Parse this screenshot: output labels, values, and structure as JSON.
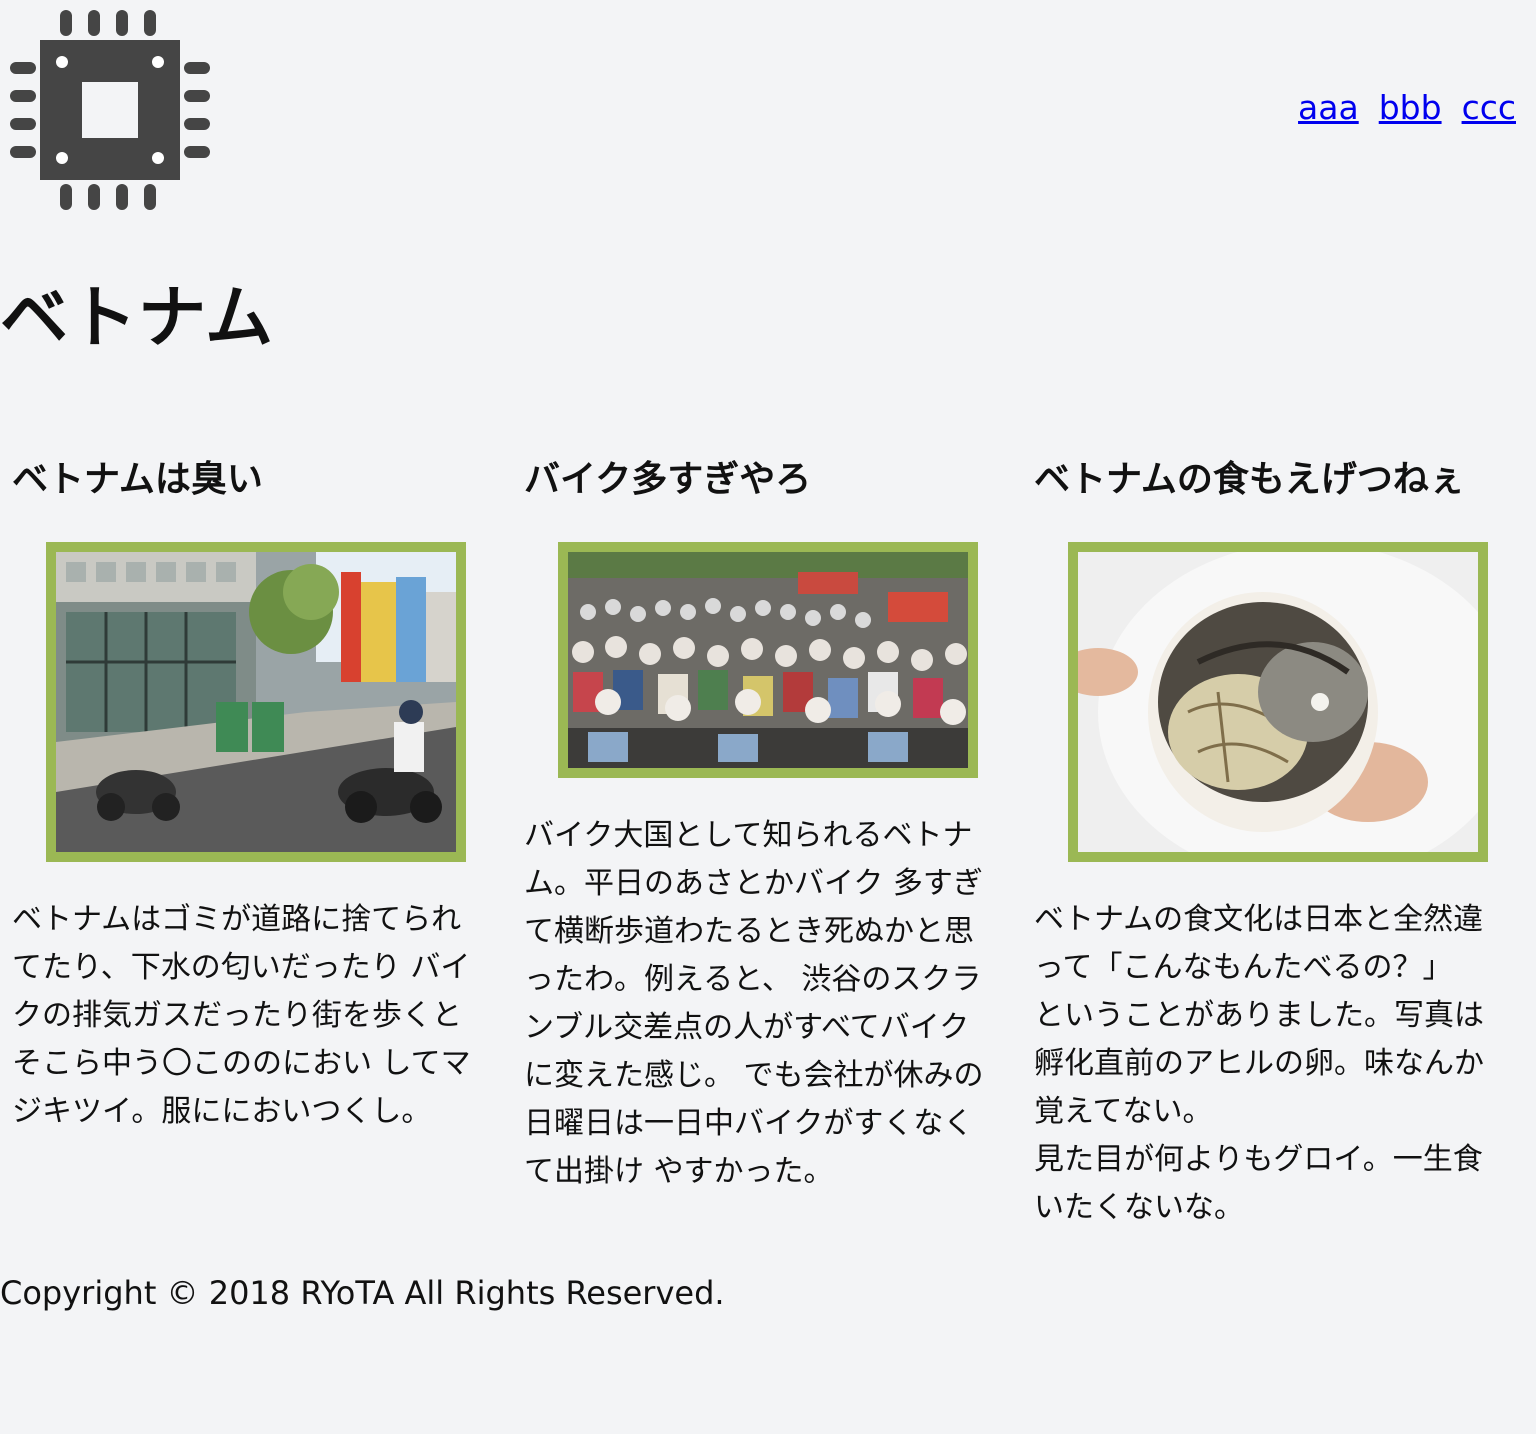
{
  "header": {
    "logo_icon": "cpu-chip-icon",
    "nav": [
      {
        "label": "aaa"
      },
      {
        "label": "bbb"
      },
      {
        "label": "ccc"
      }
    ]
  },
  "page": {
    "title": "ベトナム"
  },
  "articles": [
    {
      "heading": "ベトナムは臭い",
      "image_icon": "street-scene-photo",
      "body": "ベトナムはゴミが道路に捨てられ\nてたり、下水の匂いだったり バイ\nクの排気ガスだったり街を歩くと\nそこら中う〇こののにおい してマ\nジキツイ。服ににおいつくし。"
    },
    {
      "heading": "バイク多すぎやろ",
      "image_icon": "motorbike-crowd-photo",
      "body": "バイク大国として知られるベトナ\nム。平日のあさとかバイク 多すぎ\nて横断歩道わたるとき死ぬかと思\nったわ。例えると、 渋谷のスクラ\nンブル交差点の人がすべてバイク\nに変えた感じ。 でも会社が休みの\n日曜日は一日中バイクがすくなく\nて出掛け やすかった。"
    },
    {
      "heading": "ベトナムの食もえげつねぇ",
      "image_icon": "balut-egg-photo",
      "body": "ベトナムの食文化は日本と全然違\nって「こんなもんたべるの？」\nということがありました。写真は\n孵化直前のアヒルの卵。味なんか\n覚えてない。\n見た目が何よりもグロイ。一生食\nいたくないな。"
    }
  ],
  "footer": {
    "copyright": "Copyright © 2018 RYoTA All Rights Reserved."
  },
  "colors": {
    "background": "#f3f4f6",
    "frame": "#9bb854",
    "link": "#0000ee",
    "logo": "#454545"
  }
}
